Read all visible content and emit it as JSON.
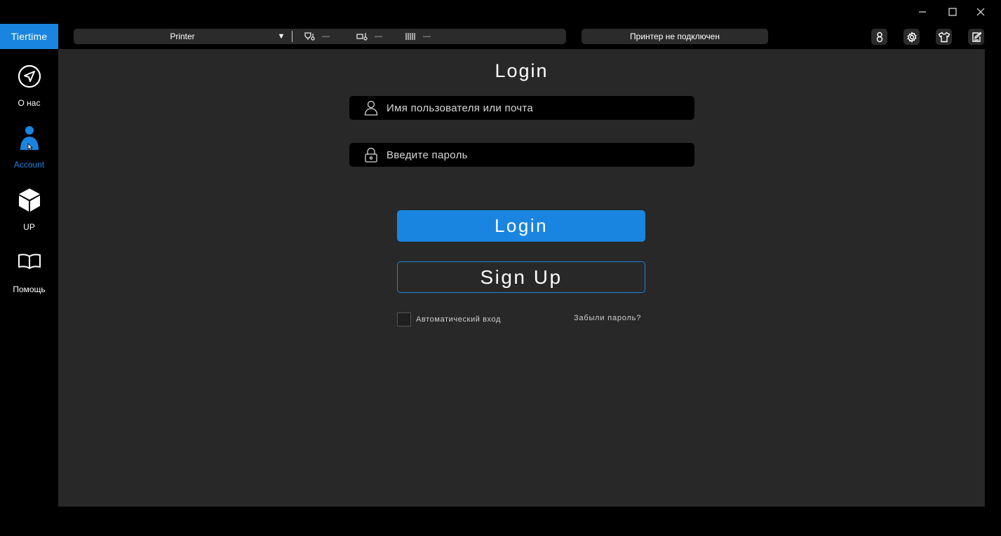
{
  "window": {
    "controls": [
      "minimize-icon",
      "maximize-icon",
      "close-icon"
    ]
  },
  "brand": {
    "logo_text": "Tiertime"
  },
  "toolbar": {
    "printer_name": "Printer",
    "printer_dropdown_glyph": "▼",
    "nozzle_temp": "—",
    "bed_temp": "—",
    "material": "—",
    "status": "Принтер не подключен",
    "icons": [
      "account-icon",
      "settings-icon",
      "tshirt-icon",
      "edit-icon"
    ]
  },
  "sidebar": {
    "items": [
      {
        "label": "О нас",
        "icon": "send-icon",
        "active": false
      },
      {
        "label": "Account",
        "icon": "person-icon",
        "active": true
      },
      {
        "label": "UP",
        "icon": "cube-icon",
        "active": false
      },
      {
        "label": "Помощь",
        "icon": "book-icon",
        "active": false
      }
    ]
  },
  "login": {
    "title": "Login",
    "username_placeholder": "Имя пользователя или почта",
    "password_placeholder": "Введите пароль",
    "login_button": "Login",
    "signup_button": "Sign Up",
    "auto_login_label": "Автоматический вход",
    "auto_login_checked": false,
    "forgot_password": "Забыли пароль?"
  },
  "colors": {
    "accent": "#1a85e0",
    "background": "#000000",
    "panel": "#282828",
    "control": "#2b2b2b"
  }
}
